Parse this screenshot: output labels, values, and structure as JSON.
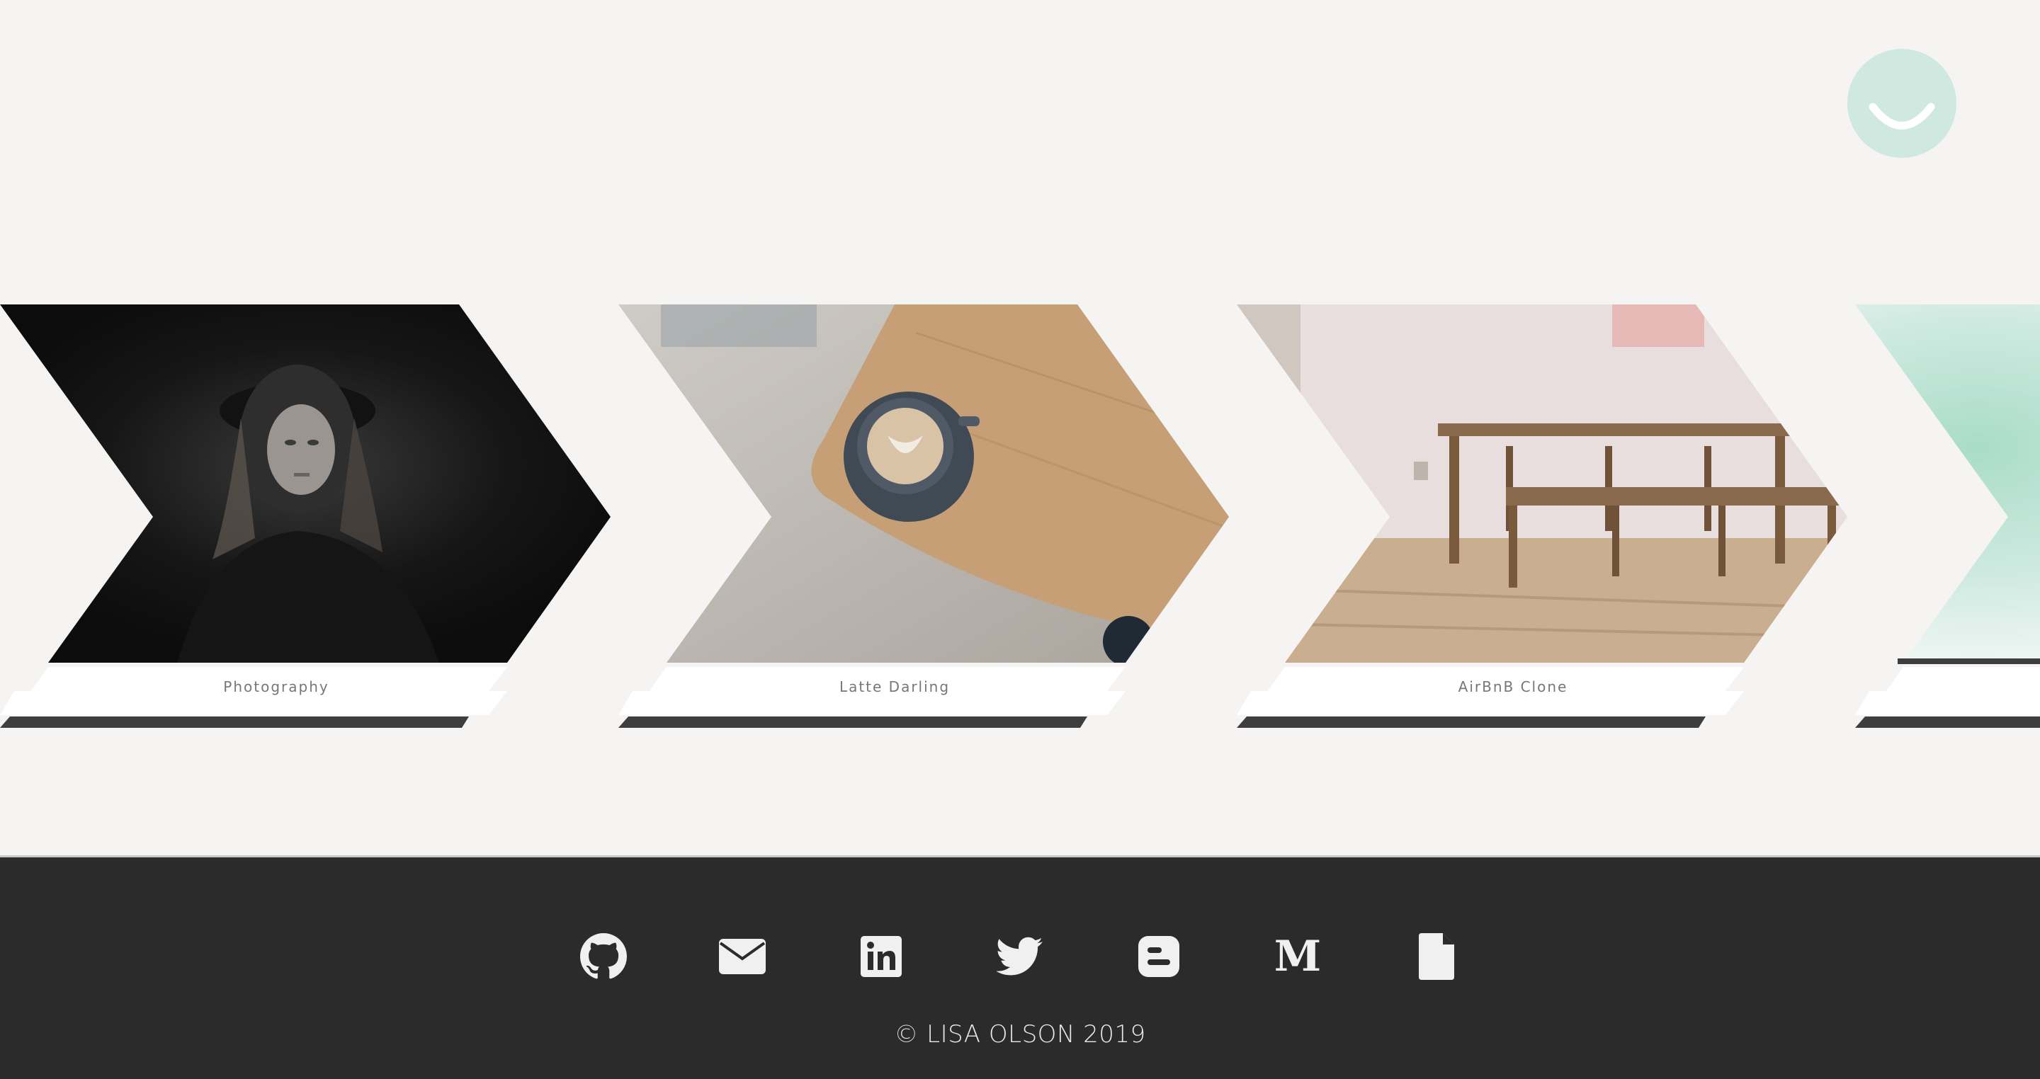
{
  "logo": {
    "icon": "smiley-icon",
    "color": "#cfe8e0"
  },
  "projects": [
    {
      "label": "Photography",
      "image": "portrait-photo",
      "theme": "dark"
    },
    {
      "label": "Latte Darling",
      "image": "latte-coffee-photo",
      "theme": "wood"
    },
    {
      "label": "AirBnB Clone",
      "image": "dining-table-photo",
      "theme": "room"
    },
    {
      "label": "",
      "image": "watercolor-mint-photo",
      "theme": "mint"
    }
  ],
  "footer": {
    "social": [
      {
        "name": "github-icon"
      },
      {
        "name": "email-icon"
      },
      {
        "name": "linkedin-icon"
      },
      {
        "name": "twitter-icon"
      },
      {
        "name": "blogger-icon"
      },
      {
        "name": "medium-icon"
      },
      {
        "name": "resume-file-icon"
      }
    ],
    "copyright": "© LISA OLSON 2019"
  },
  "colors": {
    "background": "#f5f4f2",
    "footer": "#2b2b2b",
    "bar": "#3e3e3e"
  }
}
